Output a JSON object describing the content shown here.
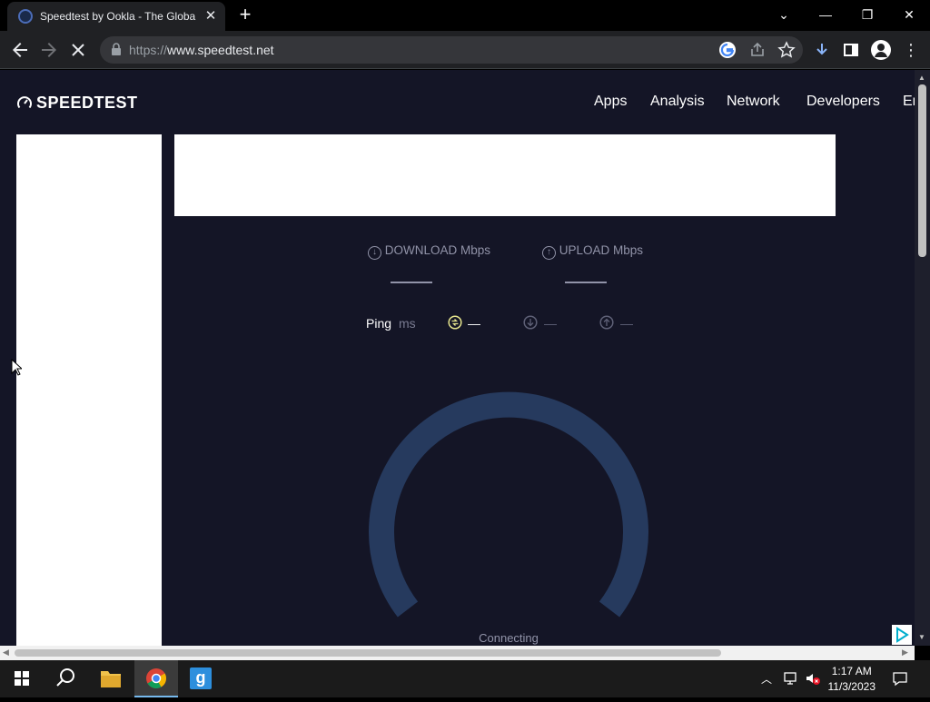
{
  "browser": {
    "tab_title": "Speedtest by Ookla - The Global",
    "tab_close": "✕",
    "new_tab": "+",
    "url_protocol": "https://",
    "url_host": "www.speedtest.net"
  },
  "window_controls": {
    "tabsearch": "⌄",
    "minimize": "—",
    "restore": "❐",
    "close": "✕"
  },
  "site": {
    "logo": "SPEEDTEST",
    "nav": [
      "Apps",
      "Analysis",
      "Network",
      "Developers",
      "En"
    ]
  },
  "results": {
    "download_label": "DOWNLOAD Mbps",
    "upload_label": "UPLOAD Mbps",
    "ping_label": "Ping",
    "ping_unit": "ms",
    "jitter_value": "—",
    "download_ping_value": "—",
    "upload_ping_value": "—",
    "status": "Connecting"
  },
  "taskbar": {
    "time": "1:17 AM",
    "date": "11/3/2023"
  },
  "colors": {
    "page_bg": "#141526",
    "gauge": "#263a5e",
    "ping_accent": "#e6e58d"
  }
}
